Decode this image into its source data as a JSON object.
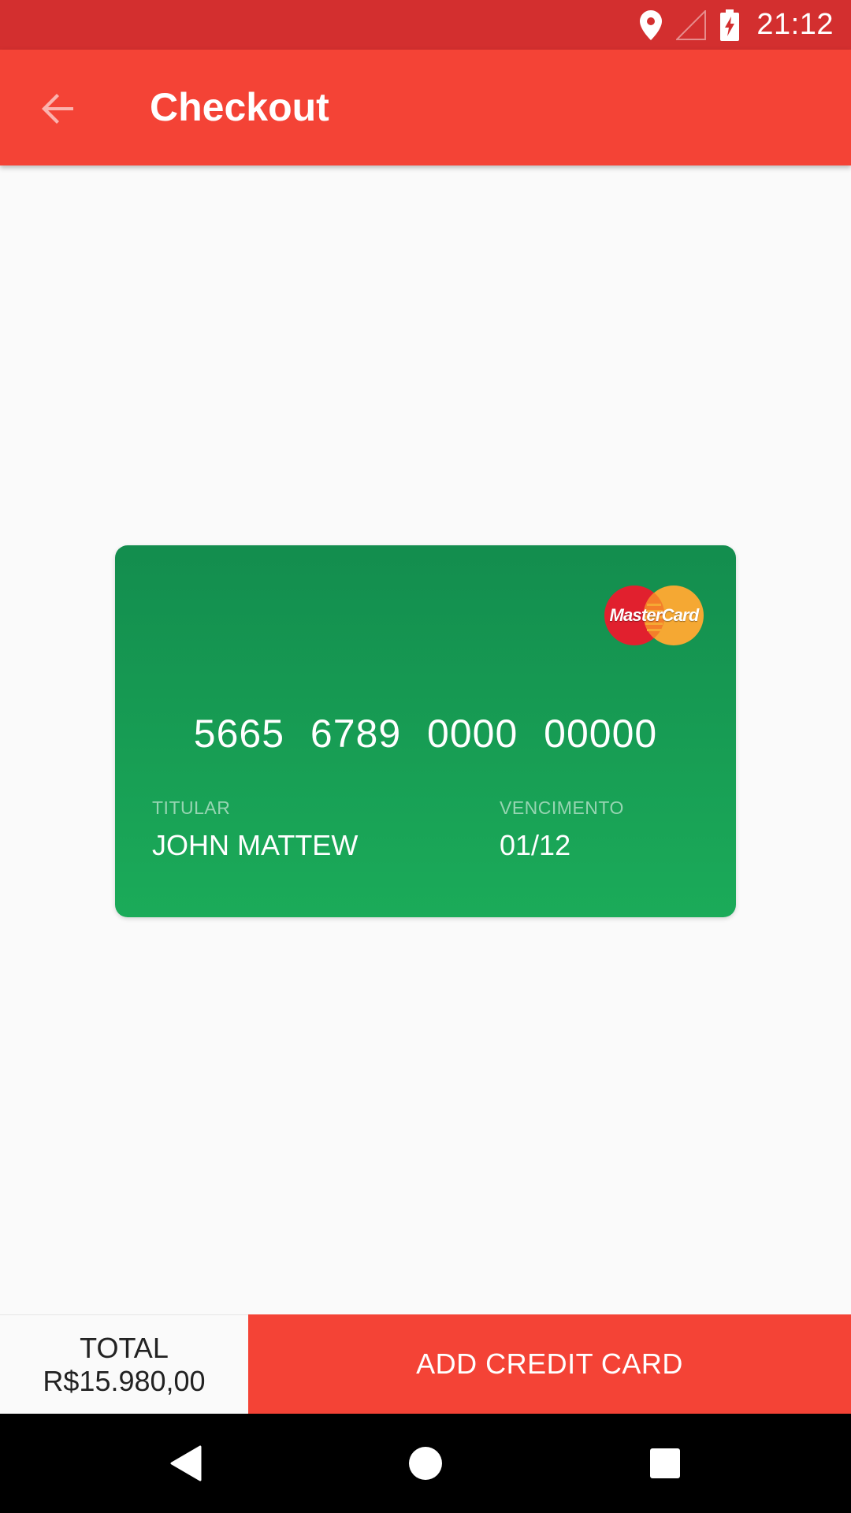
{
  "status_bar": {
    "time": "21:12",
    "icons": [
      "location-icon",
      "signal-icon",
      "battery-charging-icon"
    ]
  },
  "app_bar": {
    "title": "Checkout",
    "back_icon": "arrow-back-icon"
  },
  "card": {
    "brand": "MasterCard",
    "number": "5665 6789 0000 00000",
    "holder_label": "TITULAR",
    "holder_name": "JOHN MATTEW",
    "expiry_label": "VENCIMENTO",
    "expiry_value": "01/12",
    "colors": {
      "gradient_top": "#138d4e",
      "gradient_bottom": "#1bab59"
    }
  },
  "bottom_bar": {
    "total_label": "TOTAL",
    "total_value": "R$15.980,00",
    "action_label": "ADD CREDIT CARD"
  },
  "nav_bar": {
    "icons": [
      "back-triangle-icon",
      "home-circle-icon",
      "recents-square-icon"
    ]
  },
  "colors": {
    "primary": "#f44336",
    "primary_dark": "#d32f2f",
    "background": "#fafafa"
  }
}
